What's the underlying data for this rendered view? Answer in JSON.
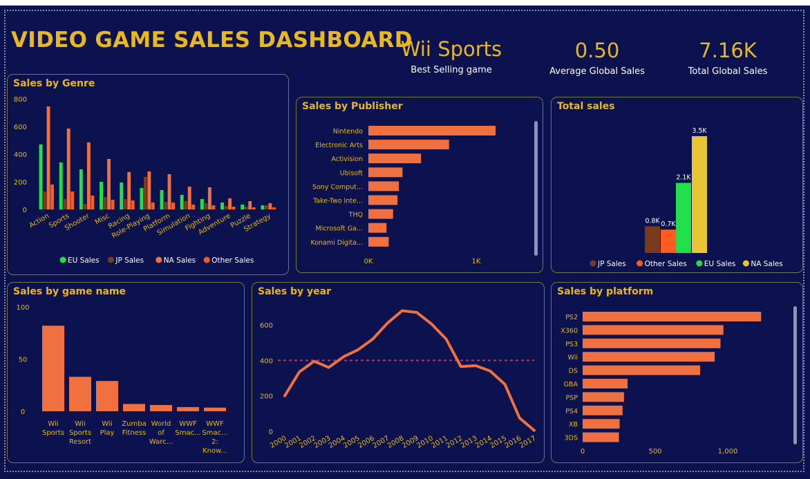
{
  "dashboard_title": "VIDEO GAME SALES DASHBOARD",
  "kpis": [
    {
      "value": "Wii Sports",
      "label": "Best Selling game"
    },
    {
      "value": "0.50",
      "label": "Average Global Sales"
    },
    {
      "value": "7.16K",
      "label": "Total Global Sales"
    }
  ],
  "colors": {
    "background": "#0b124d",
    "accent": "#e8b81e",
    "eu": "#22e04a",
    "jp": "#7a3a1c",
    "na": "#f07040",
    "other": "#ff5a1f",
    "na_total": "#e8c532"
  },
  "chart_data": [
    {
      "id": "genre",
      "type": "bar",
      "title": "Sales by Genre",
      "categories": [
        "Action",
        "Sports",
        "Shooter",
        "Misc",
        "Racing",
        "Role-Playing",
        "Platform",
        "Simulation",
        "Fighting",
        "Adventure",
        "Puzzle",
        "Strategy"
      ],
      "series": [
        {
          "name": "EU Sales",
          "color": "#22e04a",
          "values": [
            470,
            340,
            290,
            200,
            195,
            155,
            140,
            105,
            75,
            50,
            35,
            30
          ]
        },
        {
          "name": "JP Sales",
          "color": "#7a3a1c",
          "values": [
            130,
            75,
            40,
            90,
            75,
            235,
            55,
            60,
            45,
            25,
            20,
            30
          ]
        },
        {
          "name": "NA Sales",
          "color": "#f07040",
          "values": [
            745,
            585,
            485,
            365,
            270,
            275,
            255,
            165,
            160,
            80,
            60,
            45
          ]
        },
        {
          "name": "Other Sales",
          "color": "#ff5a1f",
          "values": [
            180,
            130,
            100,
            70,
            65,
            50,
            50,
            35,
            30,
            20,
            15,
            15
          ]
        }
      ],
      "yticks": [
        "0",
        "200",
        "400",
        "600",
        "800"
      ],
      "ylim": [
        0,
        800
      ],
      "legend": "bottom"
    },
    {
      "id": "publisher",
      "type": "bar",
      "orientation": "horizontal",
      "title": "Sales by Publisher",
      "categories": [
        "Nintendo",
        "Electronic Arts",
        "Activision",
        "Ubisoft",
        "Sony Comput...",
        "Take-Two Inte...",
        "THQ",
        "Microsoft Ga...",
        "Konami Digita..."
      ],
      "values": [
        1780,
        1110,
        725,
        470,
        420,
        400,
        340,
        250,
        280
      ],
      "xticks": [
        "0K",
        "1K"
      ],
      "xlim": [
        0,
        1750
      ]
    },
    {
      "id": "total",
      "type": "bar",
      "title": "Total sales",
      "categories": [
        "JP Sales",
        "Other Sales",
        "EU Sales",
        "NA Sales"
      ],
      "values": [
        0.8,
        0.7,
        2.1,
        3.5
      ],
      "data_labels": [
        "0.8K",
        "0.7K",
        "2.1K",
        "3.5K"
      ],
      "colors": [
        "#7a3a1c",
        "#ff5a1f",
        "#22e04a",
        "#e8c532"
      ],
      "legend": "bottom"
    },
    {
      "id": "game",
      "type": "bar",
      "title": "Sales by game name",
      "categories": [
        "Wii Sports",
        "Wii Sports Resort",
        "Wii Play",
        "Zumba Fitness",
        "World of Warc...",
        "WWF Smac...",
        "WWF Smac... 2: Know..."
      ],
      "values": [
        82,
        33,
        29,
        7,
        6,
        4,
        3.5
      ],
      "yticks": [
        "0",
        "50",
        "100"
      ],
      "ylim": [
        0,
        100
      ]
    },
    {
      "id": "year",
      "type": "line",
      "title": "Sales by year",
      "x": [
        "2000",
        "2001",
        "2002",
        "2003",
        "2004",
        "2005",
        "2006",
        "2007",
        "2008",
        "2009",
        "2010",
        "2011",
        "2012",
        "2013",
        "2014",
        "2015",
        "2016",
        "2017"
      ],
      "values": [
        200,
        335,
        395,
        360,
        420,
        460,
        520,
        610,
        680,
        670,
        605,
        520,
        365,
        370,
        340,
        265,
        75,
        5
      ],
      "reference_line": 400,
      "yticks": [
        "0",
        "200",
        "400",
        "600"
      ],
      "ylim": [
        0,
        700
      ]
    },
    {
      "id": "platform",
      "type": "bar",
      "orientation": "horizontal",
      "title": "Sales by platform",
      "categories": [
        "PS2",
        "X360",
        "PS3",
        "Wii",
        "DS",
        "GBA",
        "PSP",
        "PS4",
        "XB",
        "3DS"
      ],
      "values": [
        1230,
        970,
        950,
        910,
        810,
        310,
        285,
        275,
        255,
        250
      ],
      "xticks": [
        "0",
        "500",
        "1,000"
      ],
      "xlim": [
        0,
        1260
      ]
    }
  ]
}
